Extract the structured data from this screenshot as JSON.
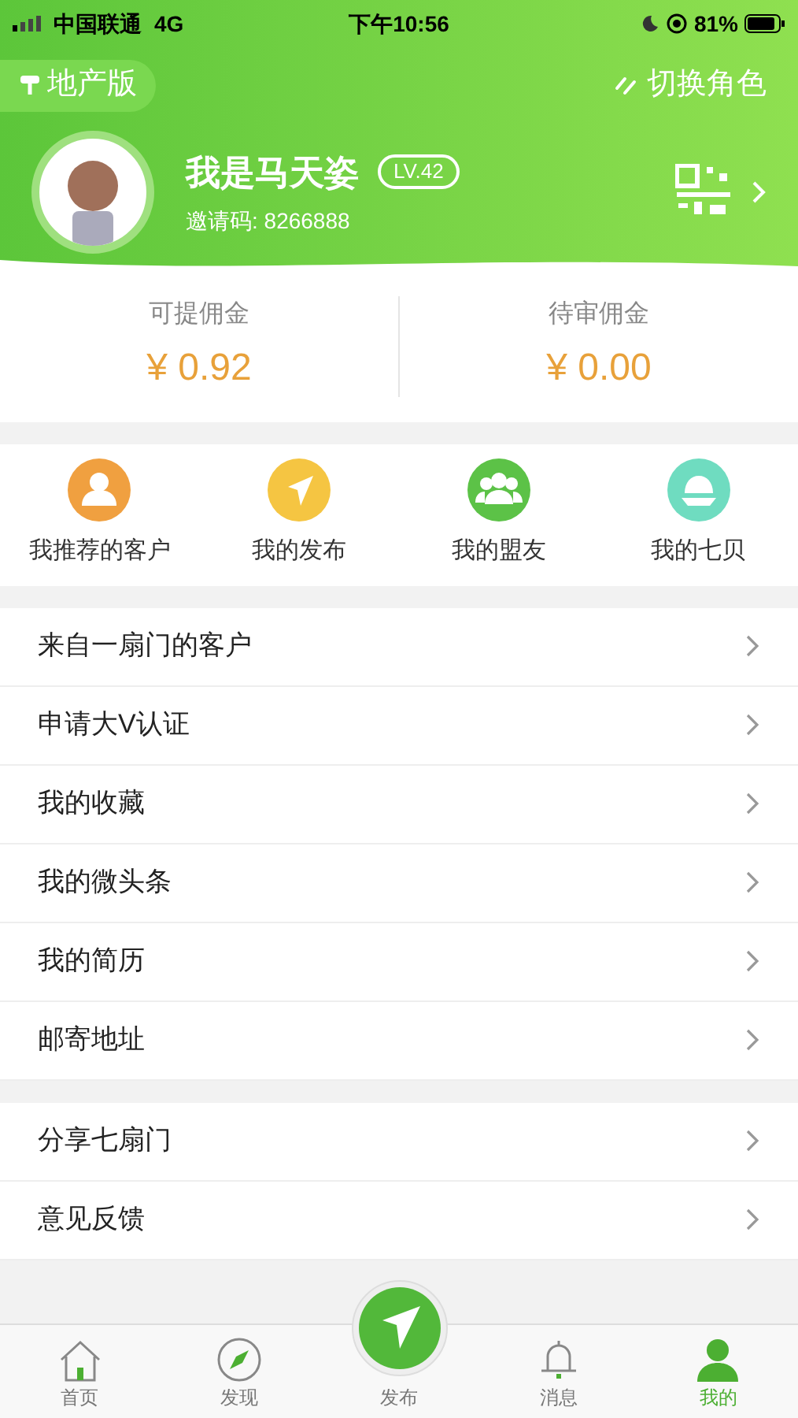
{
  "status_bar": {
    "carrier": "中国联通",
    "network": "4G",
    "time": "下午10:56",
    "battery": "81%"
  },
  "header": {
    "edition": "地产版",
    "switch_role": "切换角色",
    "name": "我是马天姿",
    "level_badge": "LV.42",
    "invite_code": "邀请码: 8266888"
  },
  "commission": [
    {
      "label": "可提佣金",
      "amount": "¥ 0.92"
    },
    {
      "label": "待审佣金",
      "amount": "¥ 0.00"
    }
  ],
  "shortcuts": [
    {
      "label": "我推荐的客户",
      "kind": "person",
      "color": "#f0a040"
    },
    {
      "label": "我的发布",
      "kind": "send",
      "color": "#f5c542"
    },
    {
      "label": "我的盟友",
      "kind": "group",
      "color": "#5cc247"
    },
    {
      "label": "我的七贝",
      "kind": "shell",
      "color": "#6fdcc0"
    }
  ],
  "menu_groups": [
    [
      "来自一扇门的客户",
      "申请大V认证",
      "我的收藏",
      "我的微头条",
      "我的简历",
      "邮寄地址"
    ],
    [
      "分享七扇门",
      "意见反馈"
    ]
  ],
  "tab_bar": [
    {
      "label": "首页",
      "kind": "home",
      "selected": false
    },
    {
      "label": "发现",
      "kind": "compass",
      "selected": false
    },
    {
      "label": "发布",
      "kind": "publish",
      "selected": false
    },
    {
      "label": "消息",
      "kind": "bell",
      "selected": false
    },
    {
      "label": "我的",
      "kind": "person",
      "selected": true
    }
  ]
}
